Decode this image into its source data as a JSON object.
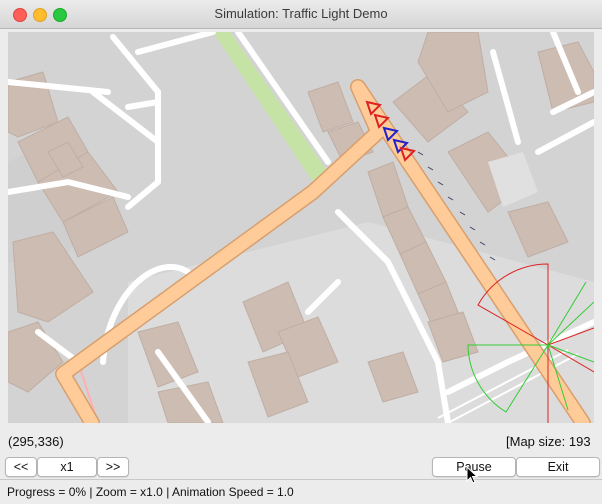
{
  "window": {
    "title": "Simulation: Traffic Light Demo"
  },
  "map": {
    "background_color": "#d2d2d2",
    "route_color": "#ffcc99"
  },
  "info": {
    "coordinates": "(295,336)",
    "map_size": "[Map size: 193"
  },
  "controls": {
    "back_label": "<<",
    "speed_label": "x1",
    "forward_label": ">>",
    "pause_label": "Pause",
    "exit_label": "Exit"
  },
  "status": {
    "text": "Progress = 0% | Zoom = x1.0 | Animation Speed = 1.0"
  }
}
